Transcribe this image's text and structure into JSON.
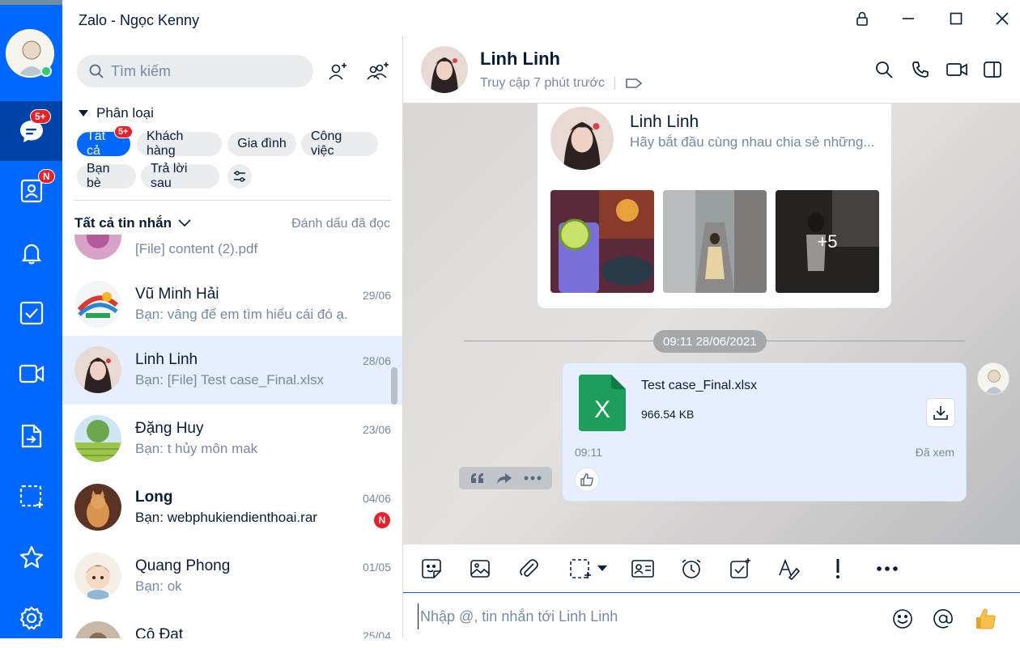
{
  "window": {
    "title": "Zalo - Ngọc Kenny",
    "controls": [
      "lock-icon",
      "minimize-icon",
      "maximize-icon",
      "close-icon"
    ]
  },
  "rail": {
    "badges": {
      "messages": "5+",
      "contacts": "N"
    },
    "items": [
      "chat-icon",
      "contacts-icon",
      "bell-icon",
      "todo-icon",
      "video-icon",
      "document-icon",
      "screenshot-icon",
      "star-icon",
      "gear-icon"
    ],
    "accent": "#0068ff",
    "active_bg": "#0043a8"
  },
  "sidebar": {
    "search_placeholder": "Tìm kiếm",
    "filter_title": "Phân loại",
    "chips": [
      "Tất cả",
      "Khách hàng",
      "Gia đình",
      "Công việc",
      "Bạn bè",
      "Trả lời sau"
    ],
    "chip_badge": "5+",
    "list_header": "Tất cả tin nhắn",
    "mark_read": "Đánh dấu đã đọc",
    "partial_preview": "[File] content (2).pdf",
    "conversations": [
      {
        "name": "Vũ Minh Hải",
        "preview": "Bạn: vâng để em tìm hiểu cái đó ạ.",
        "date": "29/06"
      },
      {
        "name": "Linh Linh",
        "preview": "Bạn: [File] Test case_Final.xlsx",
        "date": "28/06"
      },
      {
        "name": "Đặng Huy",
        "preview": "Bạn: t hủy môn mak",
        "date": "23/06"
      },
      {
        "name": "Long",
        "preview": "Bạn: webphukiendienthoai.rar",
        "date": "04/06",
        "badge": "N"
      },
      {
        "name": "Quang Phong",
        "preview": "Bạn: ok",
        "date": "01/05"
      },
      {
        "name": "Cô Đạt",
        "preview": "",
        "date": "25/04"
      }
    ]
  },
  "chat": {
    "name": "Linh Linh",
    "status": "Truy cập 7 phút trước",
    "card_name": "Linh Linh",
    "card_tagline": "Hãy bắt đầu cùng nhau chia sẻ những...",
    "more_photos": "+5",
    "timestamp": "09:11 28/06/2021",
    "file": {
      "name": "Test case_Final.xlsx",
      "size": "966.54 KB",
      "icon_letter": "X",
      "time": "09:11",
      "seen": "Đã xem",
      "excel_color": "#1e9e5b"
    }
  },
  "composer": {
    "placeholder": "Nhập @, tin nhắn tới Linh Linh",
    "toolbar": [
      "sticker-icon",
      "image-icon",
      "attachment-icon",
      "screenshot-icon",
      "contact-card-icon",
      "reminder-icon",
      "task-icon",
      "format-icon",
      "priority-icon",
      "more-icon"
    ]
  }
}
